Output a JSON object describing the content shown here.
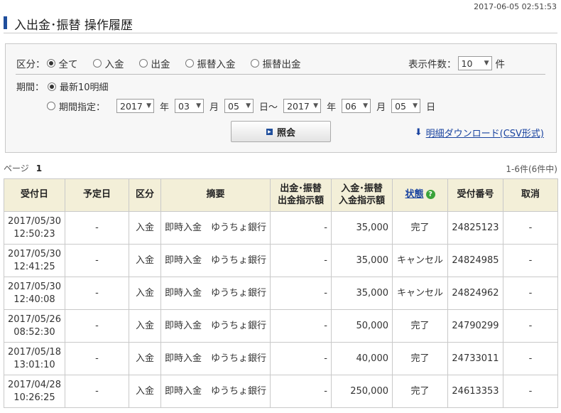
{
  "timestamp": "2017-06-05 02:51:53",
  "title": "入出金･振替 操作履歴",
  "filter": {
    "category_label": "区分：",
    "categories": [
      "全て",
      "入金",
      "出金",
      "振替入金",
      "振替出金"
    ],
    "display_count_label": "表示件数：",
    "display_count_value": "10",
    "display_count_unit": "件",
    "period_label": "期間：",
    "period_recent": "最新10明細",
    "period_specify": "期間指定：",
    "from_year": "2017",
    "from_month": "03",
    "from_day": "05",
    "to_year": "2017",
    "to_month": "06",
    "to_day": "05",
    "unit_year": "年",
    "unit_month": "月",
    "unit_day_from": "日～",
    "unit_day_to": "日",
    "search_button": "照会",
    "csv_link": "明細ダウンロード(CSV形式)"
  },
  "pagination": {
    "page_label": "ページ",
    "page_number": "1",
    "count_text": "1-6件(6件中)"
  },
  "table": {
    "headers": {
      "received_date": "受付日",
      "scheduled_date": "予定日",
      "category": "区分",
      "summary": "摘要",
      "withdraw_l1": "出金･振替",
      "withdraw_l2": "出金指示額",
      "deposit_l1": "入金･振替",
      "deposit_l2": "入金指示額",
      "status": "状態",
      "status_help": "?",
      "receipt_no": "受付番号",
      "cancel": "取消"
    },
    "rows": [
      {
        "date": "2017/05/30",
        "time": "12:50:23",
        "scheduled": "-",
        "category": "入金",
        "summary": "即時入金　ゆうちょ銀行",
        "withdraw": "-",
        "deposit": "35,000",
        "status": "完了",
        "receipt_no": "24825123",
        "cancel": "-"
      },
      {
        "date": "2017/05/30",
        "time": "12:41:25",
        "scheduled": "-",
        "category": "入金",
        "summary": "即時入金　ゆうちょ銀行",
        "withdraw": "-",
        "deposit": "35,000",
        "status": "キャンセル",
        "receipt_no": "24824985",
        "cancel": "-"
      },
      {
        "date": "2017/05/30",
        "time": "12:40:08",
        "scheduled": "-",
        "category": "入金",
        "summary": "即時入金　ゆうちょ銀行",
        "withdraw": "-",
        "deposit": "35,000",
        "status": "キャンセル",
        "receipt_no": "24824962",
        "cancel": "-"
      },
      {
        "date": "2017/05/26",
        "time": "08:52:30",
        "scheduled": "-",
        "category": "入金",
        "summary": "即時入金　ゆうちょ銀行",
        "withdraw": "-",
        "deposit": "50,000",
        "status": "完了",
        "receipt_no": "24790299",
        "cancel": "-"
      },
      {
        "date": "2017/05/18",
        "time": "13:01:10",
        "scheduled": "-",
        "category": "入金",
        "summary": "即時入金　ゆうちょ銀行",
        "withdraw": "-",
        "deposit": "40,000",
        "status": "完了",
        "receipt_no": "24733011",
        "cancel": "-"
      },
      {
        "date": "2017/04/28",
        "time": "10:26:25",
        "scheduled": "-",
        "category": "入金",
        "summary": "即時入金　ゆうちょ銀行",
        "withdraw": "-",
        "deposit": "250,000",
        "status": "完了",
        "receipt_no": "24613353",
        "cancel": "-"
      }
    ]
  }
}
